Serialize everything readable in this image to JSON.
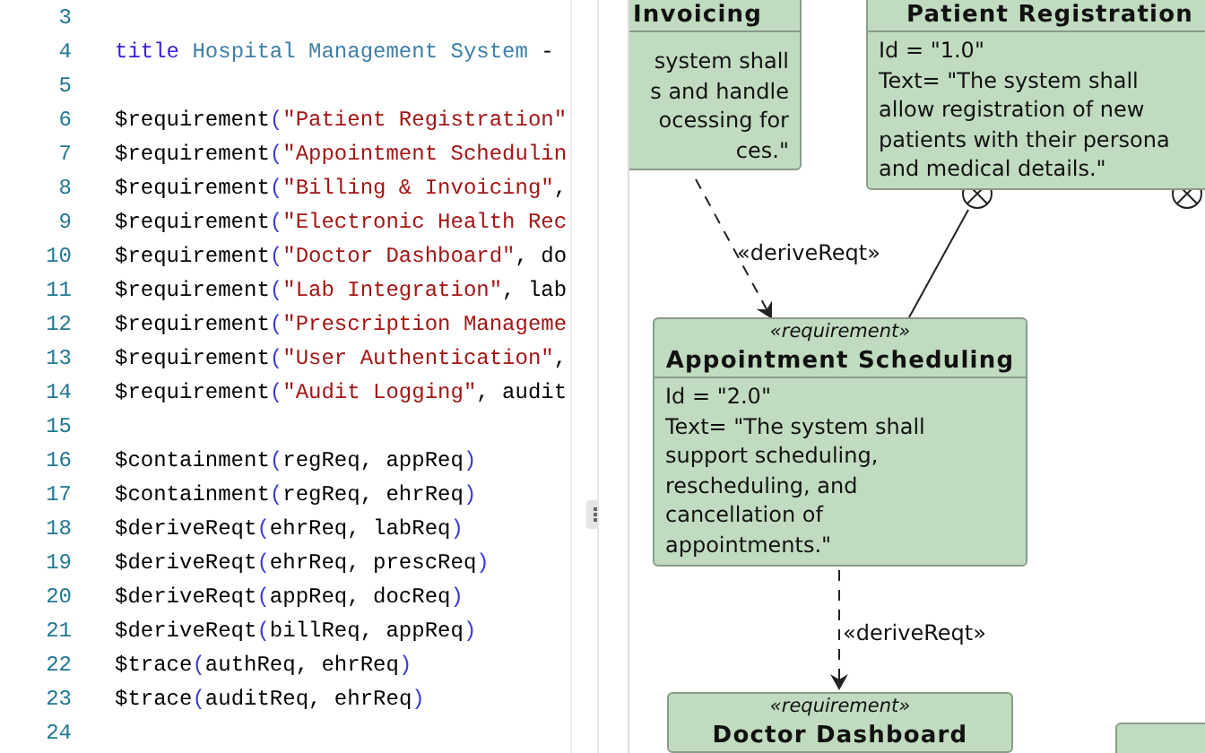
{
  "editor": {
    "lines": [
      {
        "number": "3"
      },
      {
        "number": "4",
        "tokens": [
          {
            "kind": "keyword",
            "text": "title"
          },
          {
            "kind": "title",
            "text": " Hospital Management System"
          },
          {
            "kind": "plain",
            "text": " -"
          }
        ]
      },
      {
        "number": "5"
      },
      {
        "number": "6",
        "tokens": [
          {
            "kind": "func",
            "text": "$requirement"
          },
          {
            "kind": "paren",
            "text": "("
          },
          {
            "kind": "string",
            "text": "\"Patient Registration\""
          }
        ]
      },
      {
        "number": "7",
        "tokens": [
          {
            "kind": "func",
            "text": "$requirement"
          },
          {
            "kind": "paren",
            "text": "("
          },
          {
            "kind": "string",
            "text": "\"Appointment Schedulin"
          }
        ]
      },
      {
        "number": "8",
        "tokens": [
          {
            "kind": "func",
            "text": "$requirement"
          },
          {
            "kind": "paren",
            "text": "("
          },
          {
            "kind": "string",
            "text": "\"Billing & Invoicing\""
          },
          {
            "kind": "plain",
            "text": ","
          }
        ]
      },
      {
        "number": "9",
        "tokens": [
          {
            "kind": "func",
            "text": "$requirement"
          },
          {
            "kind": "paren",
            "text": "("
          },
          {
            "kind": "string",
            "text": "\"Electronic Health Rec"
          }
        ]
      },
      {
        "number": "10",
        "tokens": [
          {
            "kind": "func",
            "text": "$requirement"
          },
          {
            "kind": "paren",
            "text": "("
          },
          {
            "kind": "string",
            "text": "\"Doctor Dashboard\""
          },
          {
            "kind": "plain",
            "text": ", do"
          }
        ]
      },
      {
        "number": "11",
        "tokens": [
          {
            "kind": "func",
            "text": "$requirement"
          },
          {
            "kind": "paren",
            "text": "("
          },
          {
            "kind": "string",
            "text": "\"Lab Integration\""
          },
          {
            "kind": "plain",
            "text": ", lab"
          }
        ]
      },
      {
        "number": "12",
        "tokens": [
          {
            "kind": "func",
            "text": "$requirement"
          },
          {
            "kind": "paren",
            "text": "("
          },
          {
            "kind": "string",
            "text": "\"Prescription Manageme"
          }
        ]
      },
      {
        "number": "13",
        "tokens": [
          {
            "kind": "func",
            "text": "$requirement"
          },
          {
            "kind": "paren",
            "text": "("
          },
          {
            "kind": "string",
            "text": "\"User Authentication\""
          },
          {
            "kind": "plain",
            "text": ","
          }
        ]
      },
      {
        "number": "14",
        "tokens": [
          {
            "kind": "func",
            "text": "$requirement"
          },
          {
            "kind": "paren",
            "text": "("
          },
          {
            "kind": "string",
            "text": "\"Audit Logging\""
          },
          {
            "kind": "plain",
            "text": ", audit"
          }
        ]
      },
      {
        "number": "15"
      },
      {
        "number": "16",
        "tokens": [
          {
            "kind": "func",
            "text": "$containment"
          },
          {
            "kind": "paren",
            "text": "("
          },
          {
            "kind": "plain",
            "text": "regReq, appReq"
          },
          {
            "kind": "paren",
            "text": ")"
          }
        ]
      },
      {
        "number": "17",
        "tokens": [
          {
            "kind": "func",
            "text": "$containment"
          },
          {
            "kind": "paren",
            "text": "("
          },
          {
            "kind": "plain",
            "text": "regReq, ehrReq"
          },
          {
            "kind": "paren",
            "text": ")"
          }
        ]
      },
      {
        "number": "18",
        "tokens": [
          {
            "kind": "func",
            "text": "$deriveReqt"
          },
          {
            "kind": "paren",
            "text": "("
          },
          {
            "kind": "plain",
            "text": "ehrReq, labReq"
          },
          {
            "kind": "paren",
            "text": ")"
          }
        ]
      },
      {
        "number": "19",
        "tokens": [
          {
            "kind": "func",
            "text": "$deriveReqt"
          },
          {
            "kind": "paren",
            "text": "("
          },
          {
            "kind": "plain",
            "text": "ehrReq, prescReq"
          },
          {
            "kind": "paren",
            "text": ")"
          }
        ]
      },
      {
        "number": "20",
        "tokens": [
          {
            "kind": "func",
            "text": "$deriveReqt"
          },
          {
            "kind": "paren",
            "text": "("
          },
          {
            "kind": "plain",
            "text": "appReq, docReq"
          },
          {
            "kind": "paren",
            "text": ")"
          }
        ]
      },
      {
        "number": "21",
        "tokens": [
          {
            "kind": "func",
            "text": "$deriveReqt"
          },
          {
            "kind": "paren",
            "text": "("
          },
          {
            "kind": "plain",
            "text": "billReq, appReq"
          },
          {
            "kind": "paren",
            "text": ")"
          }
        ]
      },
      {
        "number": "22",
        "tokens": [
          {
            "kind": "func",
            "text": "$trace"
          },
          {
            "kind": "paren",
            "text": "("
          },
          {
            "kind": "plain",
            "text": "authReq, ehrReq"
          },
          {
            "kind": "paren",
            "text": ")"
          }
        ]
      },
      {
        "number": "23",
        "tokens": [
          {
            "kind": "func",
            "text": "$trace"
          },
          {
            "kind": "paren",
            "text": "("
          },
          {
            "kind": "plain",
            "text": "auditReq, ehrReq"
          },
          {
            "kind": "paren",
            "text": ")"
          }
        ]
      },
      {
        "number": "24"
      }
    ]
  },
  "diagram": {
    "nodes": [
      {
        "title": "Invoicing",
        "body": [
          "system shall",
          "s and handle",
          "ocessing for",
          "ces.\""
        ]
      },
      {
        "title": "Patient Registration",
        "body": [
          "Id =  \"1.0\"",
          "Text= \"The system shall",
          "allow registration of new",
          "patients with their persona",
          "and medical details.\""
        ]
      },
      {
        "stereotype": "«requirement»",
        "title": "Appointment Scheduling",
        "body": [
          "Id =  \"2.0\"",
          "Text= \"The system shall",
          "support scheduling,",
          "rescheduling, and",
          "cancellation of",
          "appointments.\""
        ]
      },
      {
        "stereotype": "«requirement»",
        "title": "Doctor Dashboard"
      }
    ],
    "edges": [
      {
        "kind": "derive",
        "label": "«deriveReqt»"
      },
      {
        "kind": "containment"
      },
      {
        "kind": "containment"
      },
      {
        "kind": "derive",
        "label": "«deriveReqt»"
      }
    ]
  }
}
